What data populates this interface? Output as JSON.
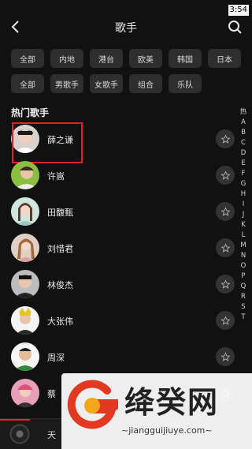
{
  "status": {
    "time": "3:54"
  },
  "nav": {
    "title": "歌手",
    "back_icon": "back-arrow-icon",
    "search_icon": "search-icon"
  },
  "filters": {
    "region": [
      "全部",
      "内地",
      "港台",
      "欧美",
      "韩国",
      "日本"
    ],
    "type": [
      "全部",
      "男歌手",
      "女歌手",
      "组合",
      "乐队"
    ]
  },
  "section": {
    "title": "热门歌手"
  },
  "alpha_index": [
    "热",
    "A",
    "B",
    "C",
    "D",
    "E",
    "F",
    "G",
    "H",
    "I",
    "J",
    "K",
    "L",
    "M",
    "N",
    "O",
    "P",
    "Q",
    "R",
    "S",
    "T"
  ],
  "singers": [
    {
      "name": "薛之谦",
      "highlighted": true
    },
    {
      "name": "许嵩"
    },
    {
      "name": "田馥甄"
    },
    {
      "name": "刘惜君"
    },
    {
      "name": "林俊杰"
    },
    {
      "name": "大张伟"
    },
    {
      "name": "周深"
    },
    {
      "name": "蔡"
    }
  ],
  "player": {
    "now_playing": "天"
  },
  "watermark": {
    "brand": "绛癸网",
    "url": "~jiangguijiuye.com~"
  },
  "colors": {
    "background": "#111111",
    "chip": "#2e2e2e",
    "highlight": "#e0202a"
  }
}
